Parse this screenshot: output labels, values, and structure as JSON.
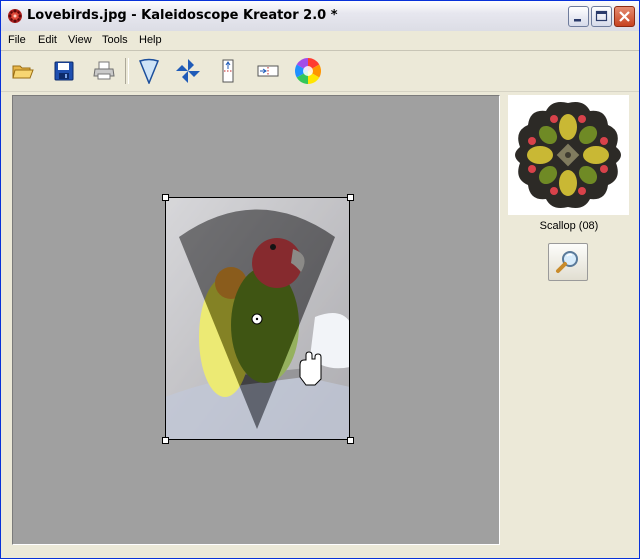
{
  "window": {
    "title": "Lovebirds.jpg - Kaleidoscope Kreator 2.0 *",
    "accent": "#0831d9"
  },
  "menu": {
    "items": [
      "File",
      "Edit",
      "View",
      "Tools",
      "Help"
    ]
  },
  "toolbar": {
    "tools": [
      "open-folder-icon",
      "save-disk-icon",
      "print-icon",
      "wedge-shape-icon",
      "pinwheel-icon",
      "vertical-mirror-icon",
      "horizontal-mirror-icon",
      "color-wheel-icon"
    ]
  },
  "canvas": {
    "background": "#a0a0a0"
  },
  "preview": {
    "label": "Scallop (08)"
  }
}
